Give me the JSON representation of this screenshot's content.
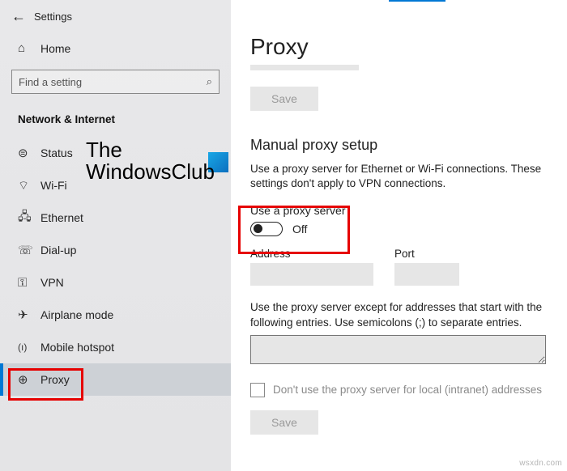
{
  "sidebar": {
    "back_glyph": "←",
    "title": "Settings",
    "home_glyph": "⌂",
    "home_label": "Home",
    "search_placeholder": "Find a setting",
    "search_glyph": "⌕",
    "category": "Network & Internet",
    "items": [
      {
        "icon": "⊜",
        "label": "Status",
        "name": "status"
      },
      {
        "icon": "⌔",
        "label": "Wi-Fi",
        "name": "wifi"
      },
      {
        "icon": "🖧",
        "label": "Ethernet",
        "name": "ethernet"
      },
      {
        "icon": "☏",
        "label": "Dial-up",
        "name": "dialup"
      },
      {
        "icon": "⚿",
        "label": "VPN",
        "name": "vpn"
      },
      {
        "icon": "✈",
        "label": "Airplane mode",
        "name": "airplane"
      },
      {
        "icon": "(ı)",
        "label": "Mobile hotspot",
        "name": "hotspot"
      },
      {
        "icon": "⊕",
        "label": "Proxy",
        "name": "proxy",
        "selected": true
      }
    ]
  },
  "main": {
    "page_title": "Proxy",
    "save_label": "Save",
    "section_title": "Manual proxy setup",
    "section_desc": "Use a proxy server for Ethernet or Wi-Fi connections. These settings don't apply to VPN connections.",
    "toggle_label": "Use a proxy server",
    "toggle_state": "Off",
    "address_label": "Address",
    "port_label": "Port",
    "exclusion_desc": "Use the proxy server except for addresses that start with the following entries. Use semicolons (;) to separate entries.",
    "checkbox_label": "Don't use the proxy server for local (intranet) addresses",
    "save_label2": "Save"
  },
  "watermark": {
    "line1": "The",
    "line2": "WindowsClub"
  },
  "footer": "wsxdn.com"
}
